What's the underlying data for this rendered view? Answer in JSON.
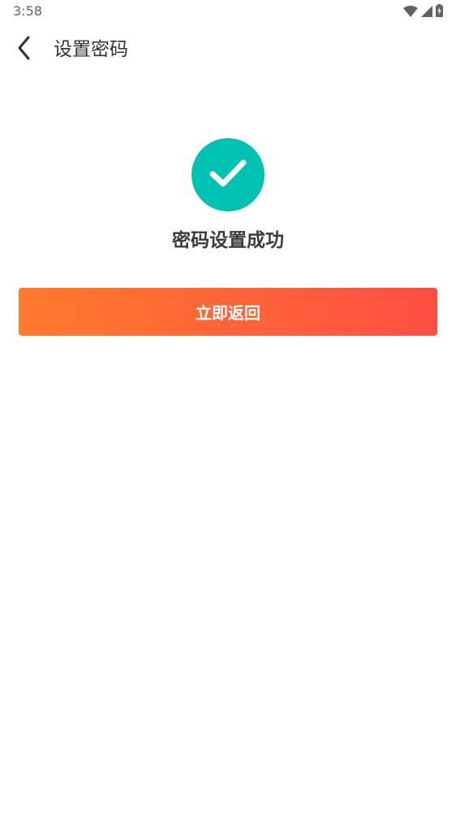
{
  "status_bar": {
    "time": "3:58",
    "icons": [
      "wifi-icon",
      "cellular-signal-icon",
      "battery-charging-icon"
    ]
  },
  "app_bar": {
    "back_icon": "chevron-left-icon",
    "title": "设置密码"
  },
  "result": {
    "icon": "checkmark-icon",
    "message": "密码设置成功"
  },
  "actions": {
    "return_label": "立即返回"
  },
  "colors": {
    "success": "#00c2b2",
    "button_gradient_start": "#ff7a2c",
    "button_gradient_end": "#ff4f44",
    "title_text": "#303133"
  }
}
